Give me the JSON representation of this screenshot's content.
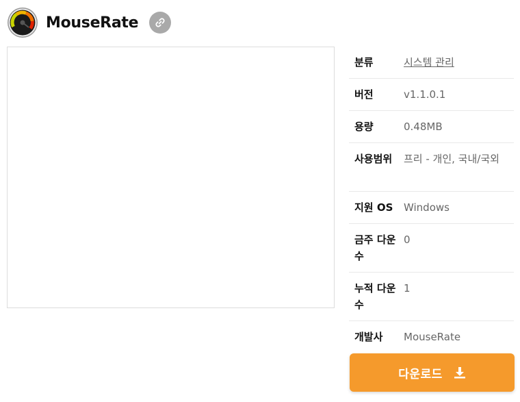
{
  "header": {
    "title": "MouseRate",
    "app_icon": "gauge-icon",
    "link_icon": "link-icon"
  },
  "info": [
    {
      "label": "분류",
      "value": "시스템 관리",
      "is_link": true
    },
    {
      "label": "버전",
      "value": "v1.1.0.1"
    },
    {
      "label": "용량",
      "value": "0.48MB"
    },
    {
      "label": "사용범위",
      "value": "프리 - 개인, 국내/국외"
    },
    {
      "label": "지원 OS",
      "value": "Windows"
    },
    {
      "label": "금주 다운수",
      "value": "0"
    },
    {
      "label": "누적 다운수",
      "value": "1"
    },
    {
      "label": "개발사",
      "value": "MouseRate"
    }
  ],
  "download": {
    "label": "다운로드",
    "icon": "download-icon"
  },
  "colors": {
    "accent": "#f59a2c",
    "link_button": "#a9a9a9",
    "border": "#dcdcdc"
  }
}
